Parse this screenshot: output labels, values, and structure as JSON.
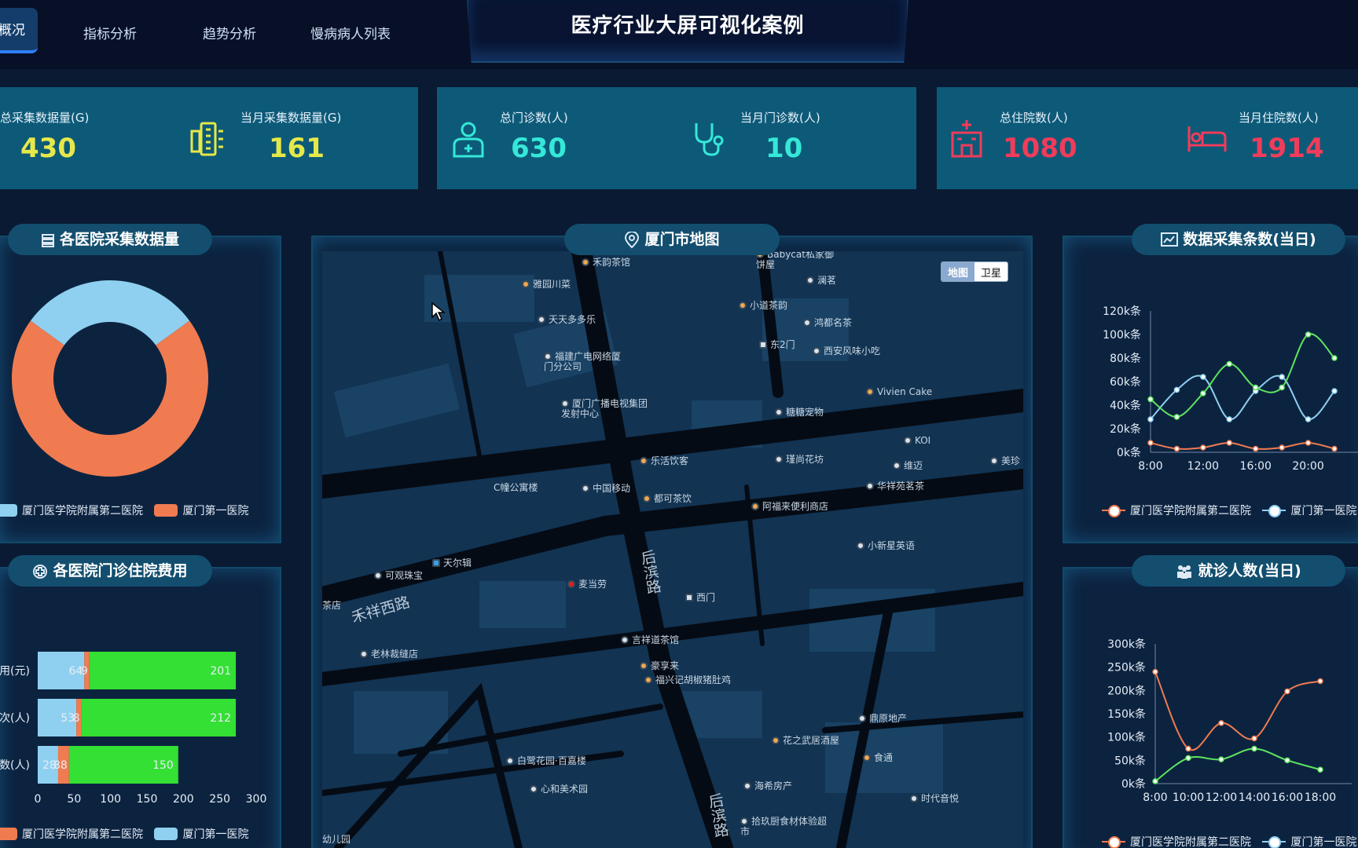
{
  "header": {
    "title": "医疗行业大屏可视化案例",
    "tabs": [
      {
        "label": "概况",
        "active": true
      },
      {
        "label": "指标分析",
        "active": false
      },
      {
        "label": "趋势分析",
        "active": false
      },
      {
        "label": "慢病病人列表",
        "active": false
      }
    ]
  },
  "stats": {
    "total_collected": {
      "label": "总采集数据量(G)",
      "value": "430",
      "color": "#e6e84a"
    },
    "month_collected": {
      "label": "当月采集数据量(G)",
      "value": "161",
      "color": "#e6e84a"
    },
    "total_outpatient": {
      "label": "总门诊数(人)",
      "value": "630",
      "color": "#35e8d8"
    },
    "month_outpatient": {
      "label": "当月门诊数(人)",
      "value": "10",
      "color": "#35e8d8"
    },
    "total_inpatient": {
      "label": "总住院数(人)",
      "value": "1080",
      "color": "#f03c5a"
    },
    "month_inpatient": {
      "label": "当月住院数(人)",
      "value": "1914",
      "color": "#f03c5a"
    }
  },
  "panels": {
    "hospital_data": {
      "title": "各医院采集数据量"
    },
    "hospital_costs": {
      "title": "各医院门诊住院费用"
    },
    "map": {
      "title": "厦门市地图",
      "toggle_map": "地图",
      "toggle_satellite": "卫星"
    },
    "daily_collection": {
      "title": "数据采集条数(当日)"
    },
    "daily_visits": {
      "title": "就诊人数(当日)"
    }
  },
  "legends": {
    "hospital_a": "厦门医学院附属第二医院",
    "hospital_b": "厦门第一医院"
  },
  "chart_data": [
    {
      "id": "hospital-data-donut",
      "type": "pie",
      "series": [
        {
          "name": "厦门医学院附属第二医院",
          "value": 30,
          "color": "#8fd0f0"
        },
        {
          "name": "厦门第一医院",
          "value": 70,
          "color": "#f07b50"
        }
      ]
    },
    {
      "id": "hospital-costs-bar",
      "type": "bar",
      "orientation": "horizontal",
      "stacked": true,
      "categories": [
        "用(元)",
        "次(人)",
        "数(人)"
      ],
      "xlim": [
        0,
        300
      ],
      "xticks": [
        0,
        50,
        100,
        150,
        200,
        250,
        300
      ],
      "series": [
        {
          "name": "厦门第一医院",
          "values": [
            64,
            53,
            28
          ],
          "labels": [
            "64",
            "53",
            "28"
          ],
          "color": "#8fd0f0"
        },
        {
          "name": "厦门医学院附属第二医院",
          "values": [
            7,
            7,
            15
          ],
          "labels": [
            "9",
            "8",
            "88"
          ],
          "color": "#f07b50"
        },
        {
          "values": [
            201,
            212,
            150
          ],
          "labels": [
            "201",
            "212",
            "150"
          ],
          "color": "#33e033"
        }
      ]
    },
    {
      "id": "daily-collection-line",
      "type": "line",
      "x": [
        "8:00",
        "10:00",
        "12:00",
        "14:00",
        "16:00",
        "18:00",
        "20:00",
        "22:00"
      ],
      "xticks": [
        "8:00",
        "12:00",
        "16:00",
        "20:00"
      ],
      "ylim": [
        0,
        120000
      ],
      "yticks": [
        "0k条",
        "20k条",
        "40k条",
        "60k条",
        "80k条",
        "100k条",
        "120k条"
      ],
      "series": [
        {
          "values": [
            8000,
            3000,
            4000,
            8000,
            3000,
            4000,
            8000,
            3000
          ],
          "color": "#f07b50"
        },
        {
          "values": [
            28000,
            53000,
            64000,
            28000,
            52000,
            64000,
            28000,
            52000
          ],
          "color": "#8fd0f0"
        },
        {
          "values": [
            45000,
            30000,
            50000,
            75000,
            55000,
            55000,
            100000,
            80000
          ],
          "color": "#5ee65e"
        }
      ]
    },
    {
      "id": "daily-visits-line",
      "type": "line",
      "x": [
        "8:00",
        "10:00",
        "12:00",
        "14:00",
        "16:00",
        "18:00"
      ],
      "ylim": [
        0,
        300000
      ],
      "yticks": [
        "0k条",
        "50k条",
        "100k条",
        "150k条",
        "200k条",
        "250k条",
        "300k条"
      ],
      "series": [
        {
          "values": [
            240000,
            75000,
            130000,
            97000,
            198000,
            220000
          ],
          "color": "#f07b50"
        },
        {
          "values": [
            5000,
            55000,
            52000,
            75000,
            50000,
            30000
          ],
          "color": "#5ee65e"
        }
      ]
    }
  ],
  "map": {
    "pois": [
      {
        "name": "禾韵茶馆"
      },
      {
        "name": "雅园川菜"
      },
      {
        "name": "天天多多乐"
      },
      {
        "name": "福建广电网络厦门分公司"
      },
      {
        "name": "厦门广播电视集团发射中心"
      },
      {
        "name": "乐活饮客"
      },
      {
        "name": "C幢公寓楼"
      },
      {
        "name": "中国移动"
      },
      {
        "name": "都可茶饮"
      },
      {
        "name": "阿福来便利商店"
      },
      {
        "name": "小新星英语"
      },
      {
        "name": "可观珠宝"
      },
      {
        "name": "天尔辑"
      },
      {
        "name": "麦当劳"
      },
      {
        "name": "西门"
      },
      {
        "name": "言祥道茶馆"
      },
      {
        "name": "老林裁缝店"
      },
      {
        "name": "豪享来"
      },
      {
        "name": "福兴记胡椒猪肚鸡"
      },
      {
        "name": "鼎原地产"
      },
      {
        "name": "花之武居酒屋"
      },
      {
        "name": "食通"
      },
      {
        "name": "白鹭花园·百嘉楼"
      },
      {
        "name": "心和美术园"
      },
      {
        "name": "海希房产"
      },
      {
        "name": "时代音悦"
      },
      {
        "name": "拾玖厨食材体验超市"
      },
      {
        "name": "小道茶韵"
      },
      {
        "name": "鸿都名茶"
      },
      {
        "name": "西安风味小吃"
      },
      {
        "name": "东2门"
      },
      {
        "name": "Vivien Cake"
      },
      {
        "name": "糖糖宠物"
      },
      {
        "name": "KOI"
      },
      {
        "name": "瑾尚花坊"
      },
      {
        "name": "维迈"
      },
      {
        "name": "华祥苑茗茶"
      },
      {
        "name": "美珍"
      },
      {
        "name": "Babycat私家御饼屋"
      },
      {
        "name": "澜茗"
      },
      {
        "name": "幼儿园"
      },
      {
        "name": "茶店"
      }
    ],
    "roads": [
      {
        "name": "禾祥西路"
      },
      {
        "name": "后滨路"
      },
      {
        "name": "后滨路"
      }
    ]
  }
}
